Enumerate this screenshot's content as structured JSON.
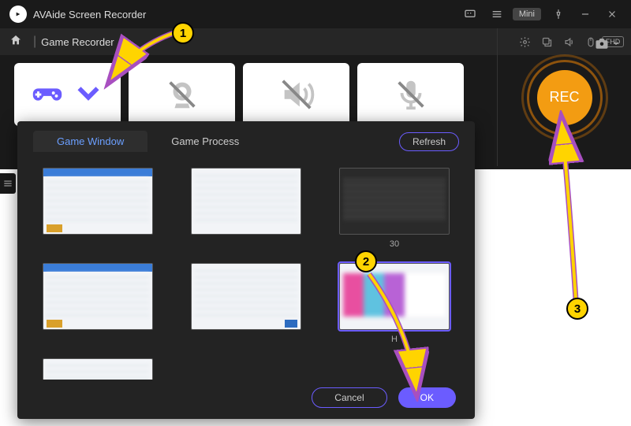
{
  "titlebar": {
    "app_name": "AVAide Screen Recorder",
    "mini_label": "Mini"
  },
  "toolbar": {
    "mode_label": "Game Recorder"
  },
  "right": {
    "rec_label": "REC"
  },
  "popup": {
    "tab_window": "Game Window",
    "tab_process": "Game Process",
    "refresh": "Refresh",
    "thumbs": [
      {
        "label": ""
      },
      {
        "label": ""
      },
      {
        "label": "30"
      },
      {
        "label": ""
      },
      {
        "label": ""
      },
      {
        "label": "H"
      },
      {
        "label": ""
      }
    ],
    "cancel": "Cancel",
    "ok": "OK"
  },
  "badges": {
    "b1": "1",
    "b2": "2",
    "b3": "3"
  }
}
